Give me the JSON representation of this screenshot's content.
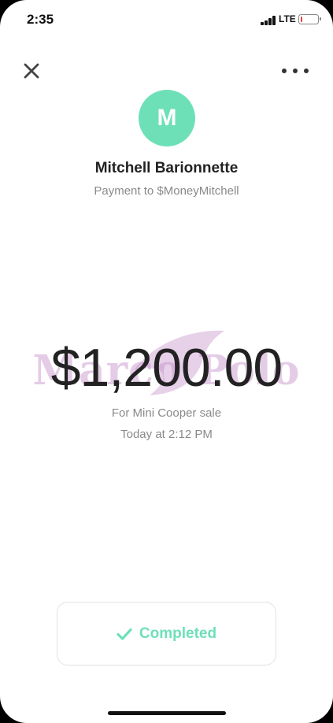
{
  "status_bar": {
    "time": "2:35",
    "network": "LTE",
    "battery_level": 0.1,
    "battery_color": "#e5443a"
  },
  "header": {
    "close_icon": "close-icon",
    "more_icon": "more-horizontal-icon"
  },
  "recipient": {
    "avatar_initial": "M",
    "avatar_color": "#6ee0b8",
    "name": "Mitchell Barionnette",
    "subtitle": "Payment to $MoneyMitchell"
  },
  "payment": {
    "amount": "$1,200.00",
    "note": "For Mini Cooper sale",
    "timestamp": "Today at 2:12 PM"
  },
  "watermark": {
    "text": "Marco Polo",
    "color": "#c48cc8"
  },
  "status_button": {
    "label": "Completed",
    "icon": "checkmark-icon",
    "color": "#6ee0b8"
  }
}
